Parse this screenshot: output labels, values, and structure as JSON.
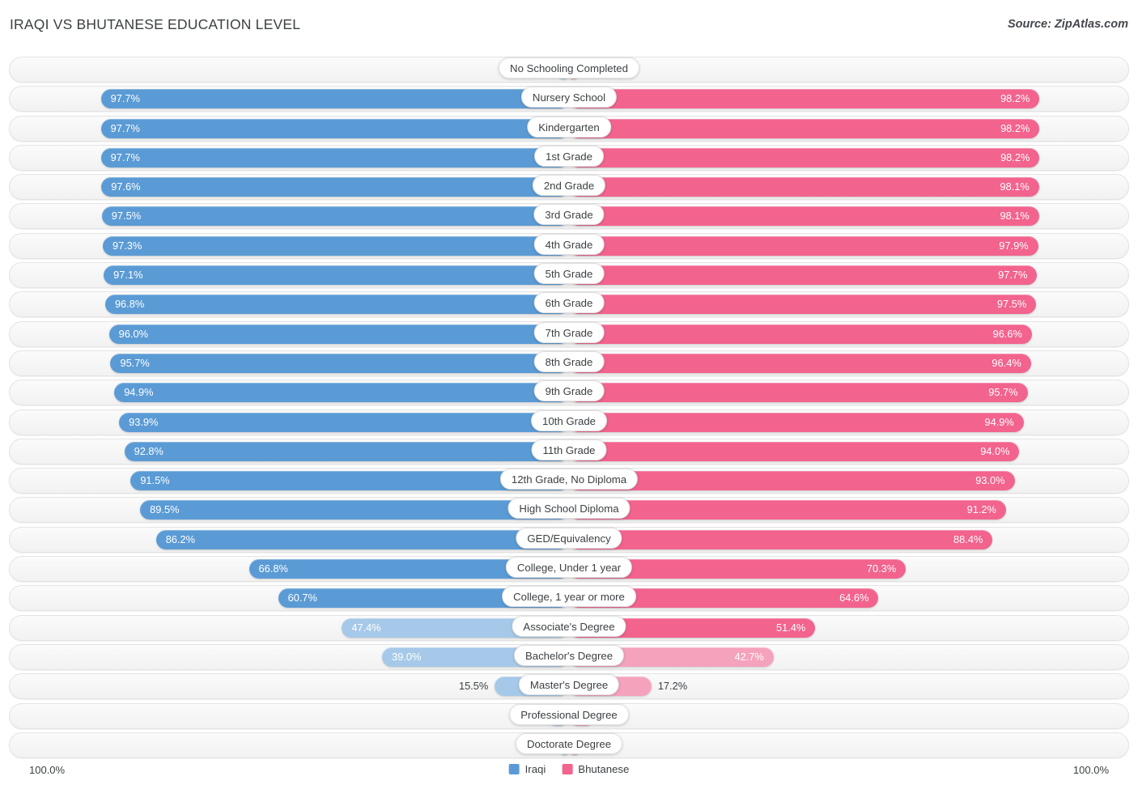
{
  "header": {
    "title": "IRAQI VS BHUTANESE EDUCATION LEVEL",
    "source": "Source: ZipAtlas.com"
  },
  "legend": {
    "left_label": "Iraqi",
    "right_label": "Bhutanese",
    "left_color": "#5b9bd5",
    "right_color": "#f2638e"
  },
  "axis": {
    "left_max": "100.0%",
    "right_max": "100.0%"
  },
  "chart_data": {
    "type": "bar",
    "title": "IRAQI VS BHUTANESE EDUCATION LEVEL",
    "subtitle": "Source: ZipAtlas.com",
    "orientation": "horizontal-diverging",
    "xlabel": "",
    "ylabel": "",
    "xlim": [
      0,
      100
    ],
    "grid": false,
    "legend_position": "bottom-center",
    "categories": [
      "No Schooling Completed",
      "Nursery School",
      "Kindergarten",
      "1st Grade",
      "2nd Grade",
      "3rd Grade",
      "4th Grade",
      "5th Grade",
      "6th Grade",
      "7th Grade",
      "8th Grade",
      "9th Grade",
      "10th Grade",
      "11th Grade",
      "12th Grade, No Diploma",
      "High School Diploma",
      "GED/Equivalency",
      "College, Under 1 year",
      "College, 1 year or more",
      "Associate's Degree",
      "Bachelor's Degree",
      "Master's Degree",
      "Professional Degree",
      "Doctorate Degree"
    ],
    "series": [
      {
        "name": "Iraqi",
        "color": "#5b9bd5",
        "values": [
          2.4,
          97.7,
          97.7,
          97.7,
          97.6,
          97.5,
          97.3,
          97.1,
          96.8,
          96.0,
          95.7,
          94.9,
          93.9,
          92.8,
          91.5,
          89.5,
          86.2,
          66.8,
          60.7,
          47.4,
          39.0,
          15.5,
          4.5,
          1.8
        ],
        "labels": [
          "2.4%",
          "97.7%",
          "97.7%",
          "97.7%",
          "97.6%",
          "97.5%",
          "97.3%",
          "97.1%",
          "96.8%",
          "96.0%",
          "95.7%",
          "94.9%",
          "93.9%",
          "92.8%",
          "91.5%",
          "89.5%",
          "86.2%",
          "66.8%",
          "60.7%",
          "47.4%",
          "39.0%",
          "15.5%",
          "4.5%",
          "1.8%"
        ]
      },
      {
        "name": "Bhutanese",
        "color": "#f2638e",
        "values": [
          1.8,
          98.2,
          98.2,
          98.2,
          98.1,
          98.1,
          97.9,
          97.7,
          97.5,
          96.6,
          96.4,
          95.7,
          94.9,
          94.0,
          93.0,
          91.2,
          88.4,
          70.3,
          64.6,
          51.4,
          42.7,
          17.2,
          5.4,
          2.3
        ],
        "labels": [
          "1.8%",
          "98.2%",
          "98.2%",
          "98.2%",
          "98.1%",
          "98.1%",
          "97.9%",
          "97.7%",
          "97.5%",
          "96.6%",
          "96.4%",
          "95.7%",
          "94.9%",
          "94.0%",
          "93.0%",
          "91.2%",
          "88.4%",
          "70.3%",
          "64.6%",
          "51.4%",
          "42.7%",
          "17.2%",
          "5.4%",
          "2.3%"
        ]
      }
    ]
  }
}
